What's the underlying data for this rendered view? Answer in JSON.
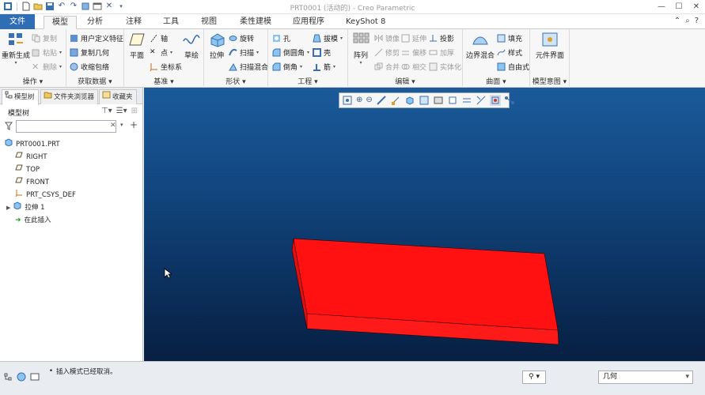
{
  "window": {
    "title": "PRT0001 (活动的) - Creo Parametric"
  },
  "tabs": [
    {
      "label": "文件"
    },
    {
      "label": "模型"
    },
    {
      "label": "分析"
    },
    {
      "label": "注释"
    },
    {
      "label": "工具"
    },
    {
      "label": "视图"
    },
    {
      "label": "柔性建模"
    },
    {
      "label": "应用程序"
    },
    {
      "label": "KeyShot 8"
    }
  ],
  "ribbon": {
    "operations": {
      "label": "操作",
      "regenerate": "重新生成",
      "copy": "复制",
      "paste": "粘贴",
      "delete": "删除"
    },
    "get_data": {
      "label": "获取数据",
      "udf": "用户定义特征",
      "copy_geometry": "复制几何",
      "shrinkwrap": "收缩包络"
    },
    "datum": {
      "label": "基准",
      "plane": "平面",
      "axis": "轴",
      "point": "点",
      "csys": "坐标系",
      "sketch": "草绘"
    },
    "shapes": {
      "label": "形状",
      "extrude": "拉伸",
      "revolve": "旋转",
      "sweep": "扫描",
      "swept_blend": "扫描混合"
    },
    "engineering": {
      "label": "工程",
      "hole": "孔",
      "round": "倒圆角",
      "chamfer": "倒角",
      "draft": "拔模",
      "shell": "壳",
      "rib": "筋"
    },
    "editing": {
      "label": "编辑",
      "pattern": "阵列",
      "mirror": "镜像",
      "trim": "修剪",
      "extend": "延伸",
      "offset": "偏移",
      "merge": "合并",
      "intersect": "相交",
      "project": "投影",
      "thicken": "加厚",
      "solidify": "实体化"
    },
    "surfaces": {
      "label": "曲面",
      "boundary_blend": "边界混合",
      "fill": "填充",
      "style": "样式",
      "freestyle": "自由式"
    },
    "model_intent": {
      "label": "模型意图",
      "component_interface": "元件界面"
    }
  },
  "panel": {
    "tabs": [
      {
        "label": "模型树"
      },
      {
        "label": "文件夹浏览器"
      },
      {
        "label": "收藏夹"
      }
    ],
    "title": "模型树",
    "search_placeholder": "",
    "tree": [
      {
        "label": "PRT0001.PRT",
        "icon": "part-icon"
      },
      {
        "label": "RIGHT",
        "icon": "datum-plane-icon"
      },
      {
        "label": "TOP",
        "icon": "datum-plane-icon"
      },
      {
        "label": "FRONT",
        "icon": "datum-plane-icon"
      },
      {
        "label": "PRT_CSYS_DEF",
        "icon": "csys-icon"
      },
      {
        "label": "拉伸 1",
        "icon": "extrude-icon"
      },
      {
        "label": "在此插入",
        "icon": "insert-arrow-icon"
      }
    ]
  },
  "viewport": {
    "part_color": "#ff1111",
    "background_top": "#1b5a9a",
    "background_bottom": "#071f42"
  },
  "status": {
    "message": "插入模式已经取消。",
    "filter": "几何"
  },
  "colors": {
    "accent": "#2f6db5",
    "tab_file_bg": "#2f6db5"
  }
}
